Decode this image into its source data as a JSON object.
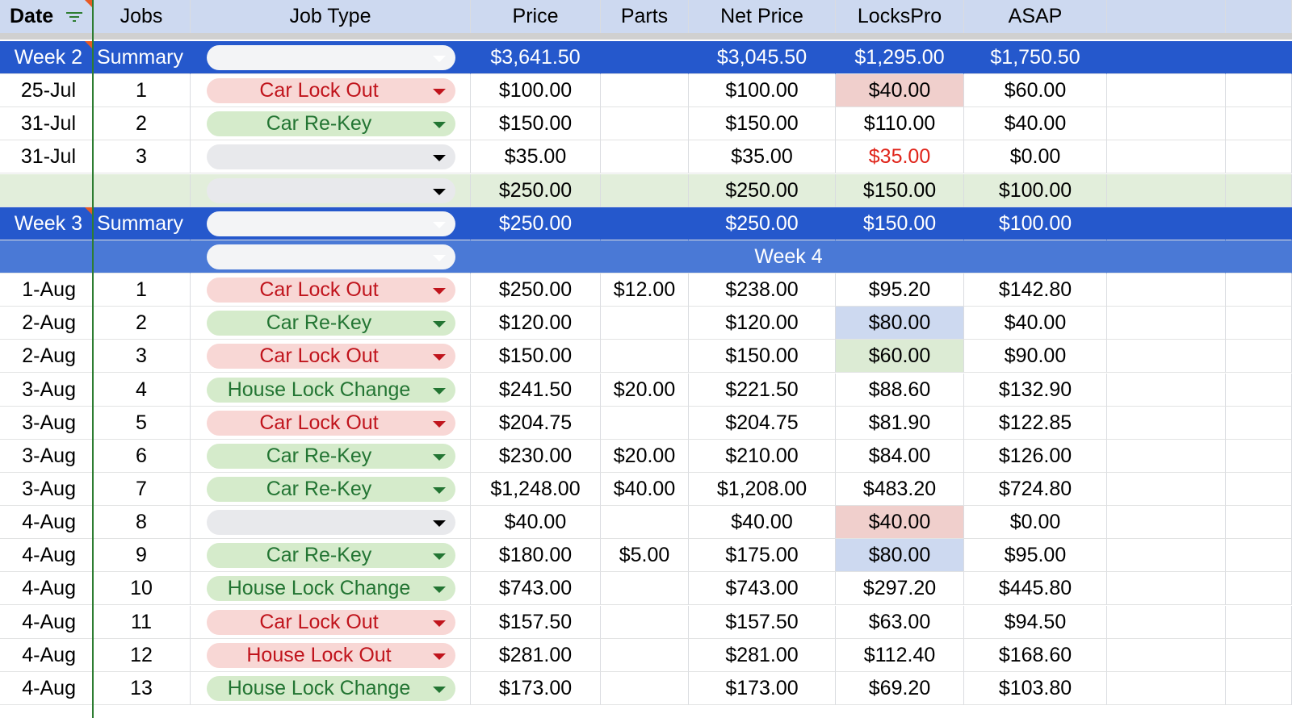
{
  "header": {
    "date": "Date",
    "jobs": "Jobs",
    "job_type": "Job Type",
    "price": "Price",
    "parts": "Parts",
    "net_price": "Net Price",
    "lockspro": "LocksPro",
    "asap": "ASAP"
  },
  "colors": {
    "header_bg": "#cdd9f0",
    "summary_bg": "#2558cc",
    "week_bg": "#4a79d6",
    "total_bg": "#e2eedb",
    "red_fill": "#f0cfcc",
    "blue_fill": "#cdd9f0",
    "green_fill": "#dcebd4",
    "red_text": "#e0251b"
  },
  "rows": [
    {
      "type": "summary",
      "date": "Week 2",
      "jobs": "Summary",
      "job_type": "",
      "chip": "white",
      "price": "$3,641.50",
      "parts": "",
      "net": "$3,045.50",
      "lockspro": "$1,295.00",
      "asap": "$1,750.50"
    },
    {
      "type": "data",
      "date": "25-Jul",
      "jobs": "1",
      "job_type": "Car Lock Out",
      "chip": "red",
      "price": "$100.00",
      "parts": "",
      "net": "$100.00",
      "lockspro": "$40.00",
      "lockspro_fill": "red",
      "asap": "$60.00"
    },
    {
      "type": "data",
      "date": "31-Jul",
      "jobs": "2",
      "job_type": "Car Re-Key",
      "chip": "green",
      "price": "$150.00",
      "parts": "",
      "net": "$150.00",
      "lockspro": "$110.00",
      "asap": "$40.00"
    },
    {
      "type": "data",
      "date": "31-Jul",
      "jobs": "3",
      "job_type": "",
      "chip": "gray",
      "price": "$35.00",
      "parts": "",
      "net": "$35.00",
      "lockspro": "$35.00",
      "lockspro_text": "red",
      "asap": "$0.00"
    },
    {
      "type": "total",
      "date": "",
      "jobs": "",
      "job_type": "",
      "chip": "gray",
      "price": "$250.00",
      "parts": "",
      "net": "$250.00",
      "lockspro": "$150.00",
      "asap": "$100.00"
    },
    {
      "type": "summary",
      "date": "Week 3",
      "jobs": "Summary",
      "job_type": "",
      "chip": "white",
      "price": "$250.00",
      "parts": "",
      "net": "$250.00",
      "lockspro": "$150.00",
      "asap": "$100.00"
    },
    {
      "type": "week",
      "date": "",
      "jobs": "",
      "job_type": "",
      "chip": "white",
      "label": "Week 4"
    },
    {
      "type": "data",
      "date": "1-Aug",
      "jobs": "1",
      "job_type": "Car Lock Out",
      "chip": "red",
      "price": "$250.00",
      "parts": "$12.00",
      "net": "$238.00",
      "lockspro": "$95.20",
      "asap": "$142.80"
    },
    {
      "type": "data",
      "date": "2-Aug",
      "jobs": "2",
      "job_type": "Car Re-Key",
      "chip": "green",
      "price": "$120.00",
      "parts": "",
      "net": "$120.00",
      "lockspro": "$80.00",
      "lockspro_fill": "blue",
      "asap": "$40.00"
    },
    {
      "type": "data",
      "date": "2-Aug",
      "jobs": "3",
      "job_type": "Car Lock Out",
      "chip": "red",
      "price": "$150.00",
      "parts": "",
      "net": "$150.00",
      "lockspro": "$60.00",
      "lockspro_fill": "green",
      "asap": "$90.00"
    },
    {
      "type": "data",
      "date": "3-Aug",
      "jobs": "4",
      "job_type": "House Lock Change",
      "chip": "green",
      "price": "$241.50",
      "parts": "$20.00",
      "net": "$221.50",
      "lockspro": "$88.60",
      "asap": "$132.90"
    },
    {
      "type": "data",
      "date": "3-Aug",
      "jobs": "5",
      "job_type": "Car Lock Out",
      "chip": "red",
      "price": "$204.75",
      "parts": "",
      "net": "$204.75",
      "lockspro": "$81.90",
      "asap": "$122.85"
    },
    {
      "type": "data",
      "date": "3-Aug",
      "jobs": "6",
      "job_type": "Car Re-Key",
      "chip": "green",
      "price": "$230.00",
      "parts": "$20.00",
      "net": "$210.00",
      "lockspro": "$84.00",
      "asap": "$126.00"
    },
    {
      "type": "data",
      "date": "3-Aug",
      "jobs": "7",
      "job_type": "Car Re-Key",
      "chip": "green",
      "price": "$1,248.00",
      "parts": "$40.00",
      "net": "$1,208.00",
      "lockspro": "$483.20",
      "asap": "$724.80"
    },
    {
      "type": "data",
      "date": "4-Aug",
      "jobs": "8",
      "job_type": "",
      "chip": "gray",
      "price": "$40.00",
      "parts": "",
      "net": "$40.00",
      "lockspro": "$40.00",
      "lockspro_fill": "red",
      "asap": "$0.00"
    },
    {
      "type": "data",
      "date": "4-Aug",
      "jobs": "9",
      "job_type": "Car Re-Key",
      "chip": "green",
      "price": "$180.00",
      "parts": "$5.00",
      "net": "$175.00",
      "lockspro": "$80.00",
      "lockspro_fill": "blue",
      "asap": "$95.00"
    },
    {
      "type": "data",
      "date": "4-Aug",
      "jobs": "10",
      "job_type": "House Lock Change",
      "chip": "green",
      "price": "$743.00",
      "parts": "",
      "net": "$743.00",
      "lockspro": "$297.20",
      "asap": "$445.80"
    },
    {
      "type": "data",
      "date": "4-Aug",
      "jobs": "11",
      "job_type": "Car Lock Out",
      "chip": "red",
      "price": "$157.50",
      "parts": "",
      "net": "$157.50",
      "lockspro": "$63.00",
      "asap": "$94.50"
    },
    {
      "type": "data",
      "date": "4-Aug",
      "jobs": "12",
      "job_type": "House Lock Out",
      "chip": "red",
      "price": "$281.00",
      "parts": "",
      "net": "$281.00",
      "lockspro": "$112.40",
      "asap": "$168.60"
    },
    {
      "type": "data",
      "date": "4-Aug",
      "jobs": "13",
      "job_type": "House Lock Change",
      "chip": "green",
      "price": "$173.00",
      "parts": "",
      "net": "$173.00",
      "lockspro": "$69.20",
      "asap": "$103.80"
    }
  ]
}
